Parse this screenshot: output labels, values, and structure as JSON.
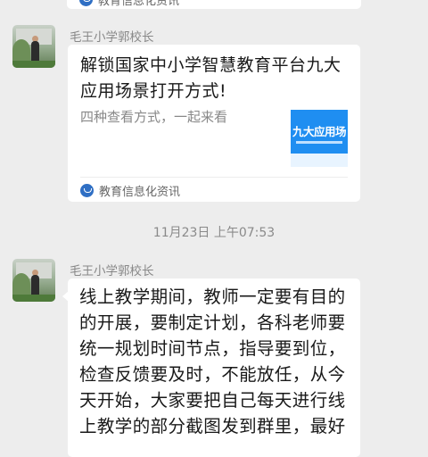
{
  "top_card": {
    "source": "教育信息化资讯"
  },
  "messages": [
    {
      "sender": "毛王小学郭校长",
      "link_card": {
        "title": "解锁国家中小学智慧教育平台九大应用场景打开方式!",
        "description": "四种查看方式，一起来看",
        "thumbnail_text": "九大应用场",
        "source": "教育信息化资讯"
      }
    },
    {
      "timestamp": "11月23日 上午07:53"
    },
    {
      "sender": "毛王小学郭校长",
      "text": "线上教学期间，教师一定要有目的的开展，要制定计划，各科老师要统一规划时间节点，指导要到位，检查反馈要及时，不能放任，从今天开始，大家要把自己每天进行线上教学的部分截图发到群里，最好"
    }
  ],
  "colors": {
    "background": "#ededed",
    "bubble": "#ffffff",
    "accent": "#1f8ef1"
  }
}
